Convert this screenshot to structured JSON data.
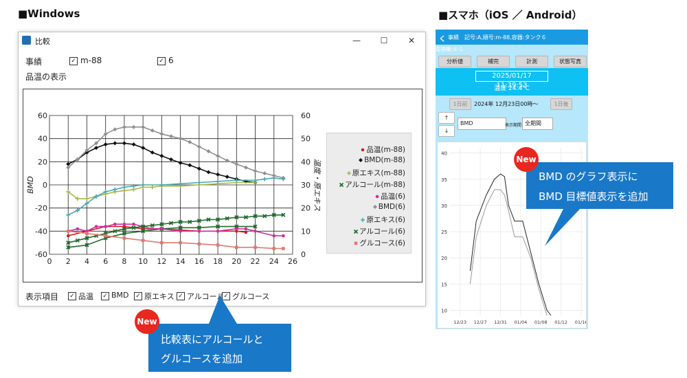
{
  "headings": {
    "windows": "■Windows",
    "phone": "■スマホ（iOS ／ Android）"
  },
  "window": {
    "title": "比較",
    "controls": {
      "minimize": "—",
      "maximize": "☐",
      "close": "✕"
    },
    "record_label": "事績",
    "records": [
      {
        "label": "m-88",
        "checked": true
      },
      {
        "label": "6",
        "checked": true
      }
    ],
    "temp_display_label": "品温の表示",
    "display_items_label": "表示項目",
    "display_items": [
      {
        "label": "品温",
        "checked": true
      },
      {
        "label": "BMD",
        "checked": true
      },
      {
        "label": "原エキス",
        "checked": true
      },
      {
        "label": "アルコール",
        "checked": true
      },
      {
        "label": "グルコース",
        "checked": true
      }
    ]
  },
  "chart_data": {
    "type": "line",
    "xlabel": "",
    "ylabel": "BMD",
    "y2label": "温度・原エキス",
    "xlim": [
      0,
      26
    ],
    "ylim": [
      -60,
      60
    ],
    "y2lim": [
      0,
      60
    ],
    "xticks": [
      0,
      2,
      4,
      6,
      8,
      10,
      12,
      14,
      16,
      18,
      20,
      22,
      24,
      26
    ],
    "yticks": [
      -60,
      -40,
      -20,
      0,
      20,
      40,
      60
    ],
    "y2ticks": [
      0,
      10,
      20,
      30,
      40,
      50,
      60
    ],
    "grid": true,
    "legend_position": "right",
    "series": [
      {
        "name": "品温(m-88)",
        "color": "#d0202a",
        "marker": "dot",
        "axis": "y2",
        "x": [
          2,
          4,
          6,
          8,
          10,
          12,
          14,
          16,
          18,
          20,
          21
        ],
        "y": [
          8,
          10,
          12,
          12,
          11,
          11,
          10.5,
          10,
          10,
          10,
          9.5
        ]
      },
      {
        "name": "BMD(m-88)",
        "color": "#111111",
        "marker": "diamond",
        "axis": "y",
        "x": [
          2,
          3,
          4,
          5,
          6,
          7,
          8,
          9,
          10,
          11,
          12,
          13,
          14,
          15,
          16,
          17,
          18,
          19,
          20,
          21,
          22
        ],
        "y": [
          18,
          22,
          28,
          32,
          35,
          36,
          36,
          35,
          32,
          28,
          25,
          22,
          19,
          17,
          14,
          11,
          9,
          7,
          5,
          3,
          2
        ]
      },
      {
        "name": "原エキス(m-88)",
        "color": "#a9b84a",
        "marker": "plus",
        "axis": "y2",
        "x": [
          2,
          3,
          4,
          5,
          6,
          7,
          8,
          9,
          10,
          11,
          12,
          14,
          16,
          18,
          20,
          22
        ],
        "y": [
          27,
          24,
          24,
          25,
          26,
          27,
          27.5,
          28,
          29,
          29,
          29.5,
          29.5,
          30,
          30.5,
          31,
          31
        ]
      },
      {
        "name": "アルコール(m-88)",
        "color": "#1f6b2a",
        "marker": "x",
        "axis": "y2",
        "x": [
          2,
          4,
          6,
          8,
          10,
          12,
          14,
          16,
          18,
          20,
          22
        ],
        "y": [
          3,
          4,
          7,
          9,
          10,
          11,
          11.5,
          11.5,
          12,
          12,
          12
        ]
      },
      {
        "name": "品温(6)",
        "color": "#d0309a",
        "marker": "dot",
        "axis": "y2",
        "x": [
          2,
          3,
          4,
          5,
          6,
          7,
          8,
          9,
          10,
          11,
          12,
          14,
          16,
          18,
          20,
          21,
          22,
          24,
          25
        ],
        "y": [
          10,
          11,
          10,
          12,
          12,
          13,
          13,
          13,
          12,
          11,
          11,
          10,
          10,
          10,
          11,
          11,
          10,
          8,
          8
        ]
      },
      {
        "name": "BMD(6)",
        "color": "#909090",
        "marker": "diamond",
        "axis": "y",
        "x": [
          2,
          3,
          4,
          5,
          6,
          7,
          8,
          9,
          10,
          11,
          12,
          13,
          14,
          15,
          16,
          17,
          18,
          19,
          20,
          21,
          22,
          23,
          24,
          25
        ],
        "y": [
          15,
          22,
          30,
          36,
          44,
          48,
          50,
          50,
          50,
          47,
          44,
          42,
          40,
          37,
          33,
          29,
          25,
          21,
          18,
          15,
          12,
          10,
          8,
          6
        ]
      },
      {
        "name": "原エキス(6)",
        "color": "#4aa8b0",
        "marker": "plus",
        "axis": "y2",
        "x": [
          2,
          3,
          4,
          5,
          6,
          7,
          8,
          9,
          10,
          12,
          14,
          16,
          18,
          20,
          22,
          23,
          24,
          25
        ],
        "y": [
          17,
          19,
          22,
          25,
          27,
          28,
          29,
          29.5,
          30,
          30,
          30.5,
          31,
          31.5,
          32,
          32,
          32.5,
          33,
          32.5
        ]
      },
      {
        "name": "アルコール(6)",
        "color": "#1f6b2a",
        "marker": "x",
        "axis": "y2",
        "x": [
          2,
          3,
          4,
          5,
          6,
          7,
          8,
          9,
          10,
          11,
          12,
          13,
          14,
          15,
          16,
          17,
          18,
          19,
          20,
          21,
          22,
          23,
          24,
          25
        ],
        "y": [
          5,
          6,
          7,
          8,
          9,
          10,
          11,
          11.5,
          12,
          12.5,
          13,
          13.5,
          14,
          14,
          14.5,
          15,
          15,
          15.5,
          16,
          16,
          16.5,
          16.5,
          17,
          17
        ]
      },
      {
        "name": "グルコース(6)",
        "color": "#e07870",
        "marker": "square",
        "axis": "y2",
        "x": [
          2,
          4,
          6,
          8,
          10,
          12,
          14,
          16,
          18,
          20,
          22,
          24,
          25
        ],
        "y": [
          10,
          9,
          8,
          7,
          6,
          5,
          5,
          4.5,
          4,
          3,
          3,
          2.5,
          2.5
        ]
      }
    ]
  },
  "phone": {
    "back": "く",
    "header": "事績　記号:A,順号:m-88,容器:タンク６",
    "subheader": "変換機:①-1",
    "tabs": [
      "分析値",
      "補完",
      "計測",
      "状態写真"
    ],
    "datetime": "2025/01/17 11:39:53",
    "temperature": "温度 24.4°C",
    "prev_day": "1日前",
    "date_range": "2024年 12月23日00時〜",
    "next_day": "1日後",
    "up": "↑",
    "down": "↓",
    "select_value": "BMD",
    "period_label": "表示期間",
    "period_value": "全期間"
  },
  "phone_chart": {
    "type": "line",
    "yticks": [
      10,
      15,
      20,
      25,
      30,
      35,
      40
    ],
    "ylim": [
      9,
      41
    ],
    "xticks": [
      "12/23",
      "12/27",
      "12/31",
      "01/04",
      "01/08",
      "01/12",
      "01/16"
    ],
    "series": [
      {
        "name": "",
        "color": "#222222",
        "x": [
          1.0,
          1.3,
          1.8,
          2.2,
          2.5,
          2.7,
          2.9,
          3.2,
          3.6,
          4.0,
          4.4,
          4.8,
          5.0
        ],
        "y": [
          17.5,
          27,
          32,
          35,
          36,
          35.5,
          30,
          27,
          27,
          21,
          15,
          10,
          9
        ]
      },
      {
        "name": "",
        "color": "#999999",
        "x": [
          1.0,
          1.3,
          1.8,
          2.2,
          2.5,
          2.7,
          2.9,
          3.2,
          3.6,
          4.0,
          4.4,
          4.8
        ],
        "y": [
          15,
          24,
          30,
          33,
          33,
          32,
          29,
          24,
          24,
          20,
          14,
          9
        ]
      }
    ]
  },
  "callouts": {
    "new_badge": "New",
    "phone_text": [
      "BMD のグラフ表示に",
      "BMD 目標値表示を追加"
    ],
    "windows_text": [
      "比較表にアルコールと",
      "グルコースを追加"
    ]
  }
}
